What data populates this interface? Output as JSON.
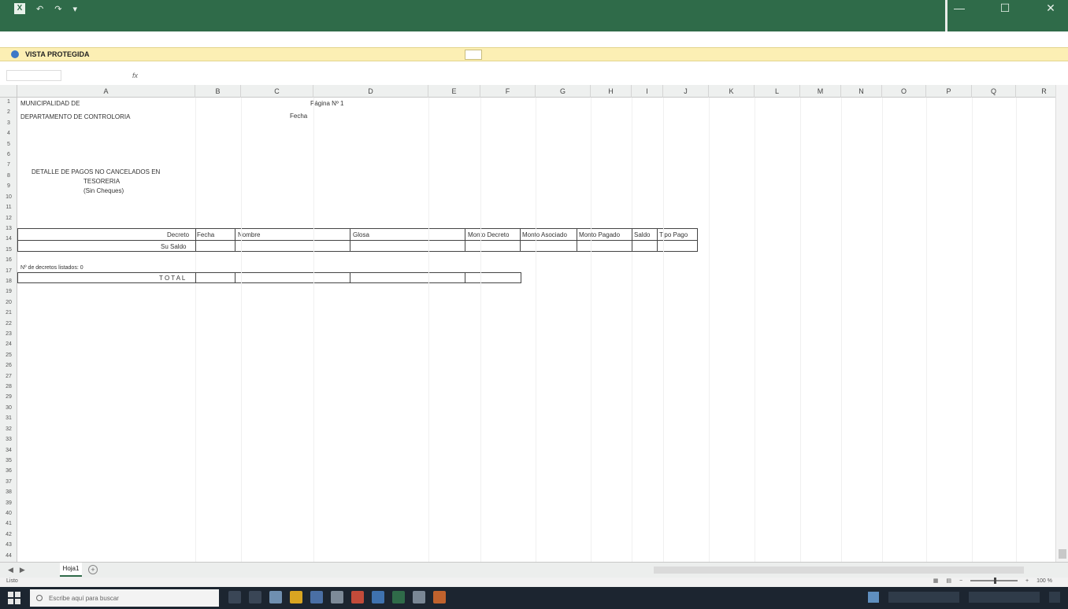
{
  "titlebar": {
    "app_letter": "X",
    "quick_access": [
      "↶",
      "↷",
      "▾"
    ],
    "title": "",
    "window_controls": [
      "—",
      "☐",
      "✕"
    ],
    "ribbon_tabs": []
  },
  "protected_view": {
    "title": "VISTA PROTEGIDA",
    "message": "",
    "button_label": ""
  },
  "formula_bar": {
    "name_box": "",
    "fx": "fx",
    "content": ""
  },
  "columns": [
    {
      "label": "A"
    },
    {
      "label": "B"
    },
    {
      "label": "C"
    },
    {
      "label": "D"
    },
    {
      "label": "E"
    },
    {
      "label": "F"
    },
    {
      "label": "G"
    },
    {
      "label": "H"
    },
    {
      "label": "I"
    },
    {
      "label": "J"
    },
    {
      "label": "K"
    },
    {
      "label": "L"
    },
    {
      "label": "M"
    },
    {
      "label": "N"
    },
    {
      "label": "O"
    },
    {
      "label": "P"
    },
    {
      "label": "Q"
    },
    {
      "label": "R"
    }
  ],
  "rows_count": 44,
  "sheet": {
    "header_lines": [
      "MUNICIPALIDAD DE",
      "DEPARTAMENTO DE CONTROLORIA",
      ""
    ],
    "page_label": "Página Nº 1",
    "date_label": "Fecha",
    "report_title_lines": [
      "DETALLE DE PAGOS NO CANCELADOS EN",
      "TESORERIA",
      "(Sin Cheques)"
    ],
    "table_headers": [
      "Decreto",
      "Fecha",
      "Nombre",
      "Glosa",
      "Monto Decreto",
      "Monto Asociado",
      "Monto Pagado",
      "Saldo",
      "Tipo Pago"
    ],
    "subtotal_label": "Su Saldo",
    "count_label": "Nº de decretos listados: 0",
    "total_label": "T O T A L"
  },
  "sheet_tabs": [
    {
      "label": "Hoja1"
    }
  ],
  "status": {
    "left": "Listo",
    "zoom": "100 %"
  },
  "taskbar": {
    "search_placeholder": "Escribe aquí para buscar"
  }
}
